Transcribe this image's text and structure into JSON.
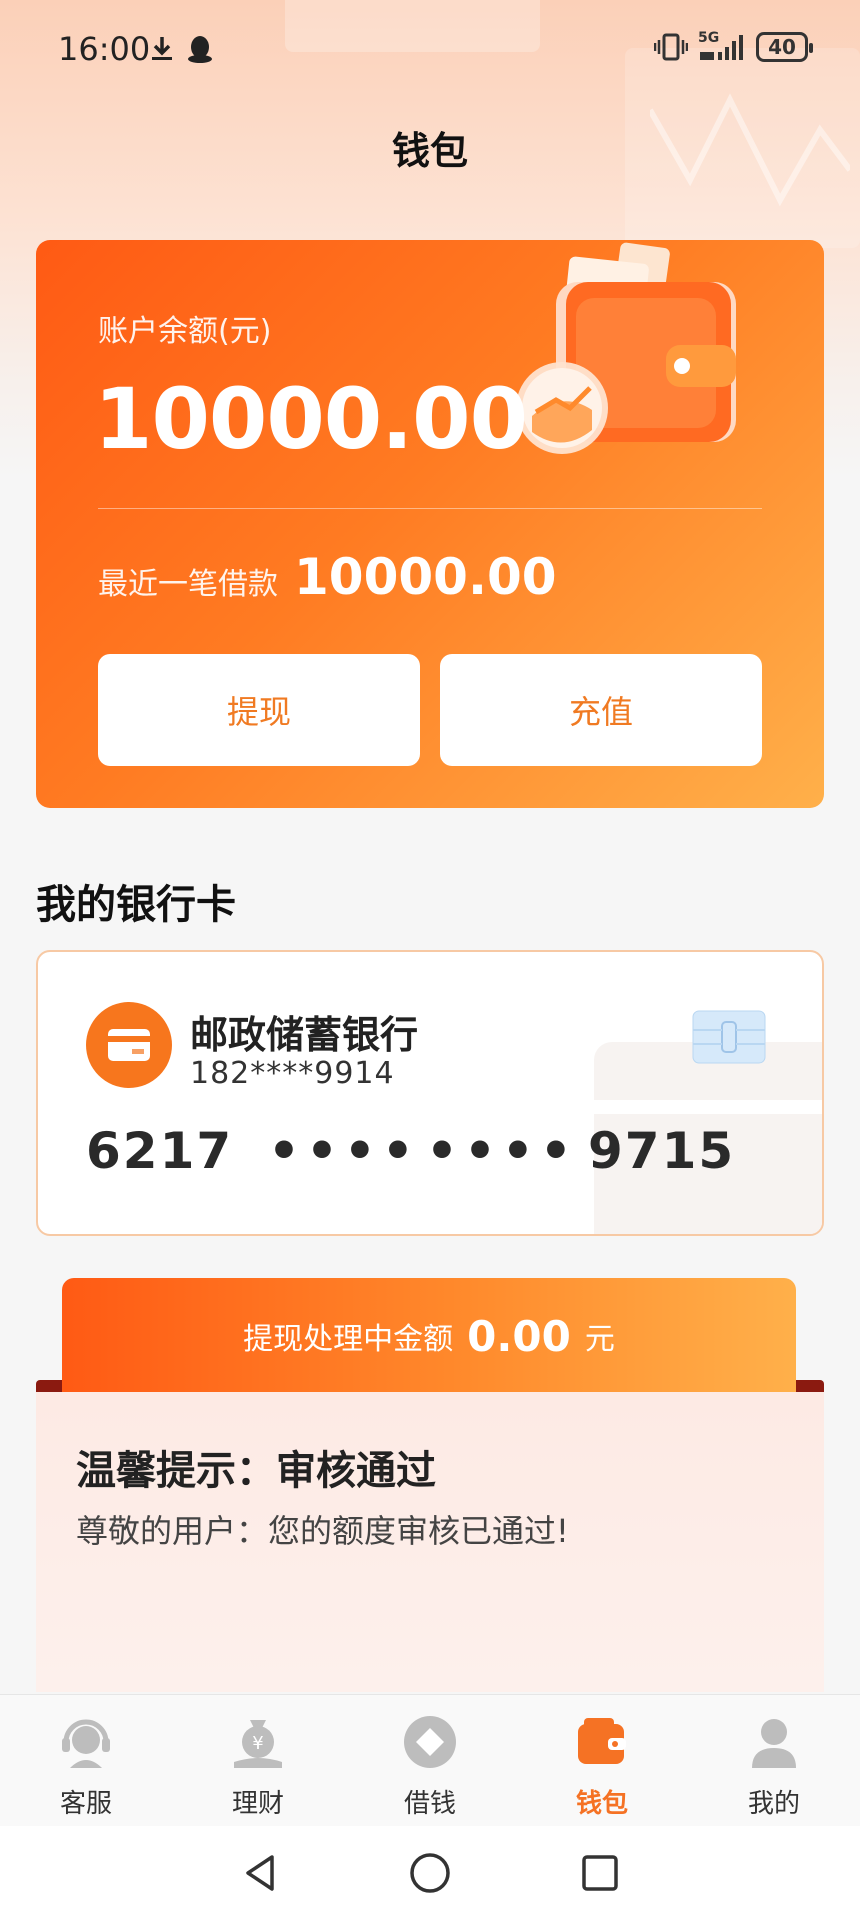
{
  "status_bar": {
    "time": "16:00",
    "network": "5G",
    "battery": "40",
    "icons": [
      "download-icon",
      "qq-penguin-icon",
      "vibrate-icon",
      "signal-icon"
    ]
  },
  "header": {
    "title": "钱包"
  },
  "balance_card": {
    "balance_label": "账户余额(元)",
    "balance_value": "10000.00",
    "recent_loan_label": "最近一笔借款",
    "recent_loan_value": "10000.00",
    "withdraw_label": "提现",
    "recharge_label": "充值"
  },
  "bank_section": {
    "title": "我的银行卡",
    "bank_name": "邮政储蓄银行",
    "phone": "182****9914",
    "card_number": [
      "6217",
      "••••",
      "••••",
      "9715"
    ]
  },
  "processing": {
    "label": "提现处理中金额",
    "value": "0.00",
    "unit": "元"
  },
  "notice": {
    "title": "温馨提示：审核通过",
    "body": "尊敬的用户：您的额度审核已通过!"
  },
  "tabs": [
    {
      "label": "客服",
      "icon": "customer-service-icon",
      "active": false
    },
    {
      "label": "理财",
      "icon": "money-bag-icon",
      "active": false
    },
    {
      "label": "借钱",
      "icon": "diamond-coin-icon",
      "active": false
    },
    {
      "label": "钱包",
      "icon": "wallet-icon",
      "active": true
    },
    {
      "label": "我的",
      "icon": "user-icon",
      "active": false
    }
  ],
  "colors": {
    "accent": "#f57224",
    "card_gradient_start": "#ff5a14",
    "card_gradient_end": "#ffb04a",
    "tab_inactive_icon": "#b8b8b8"
  }
}
